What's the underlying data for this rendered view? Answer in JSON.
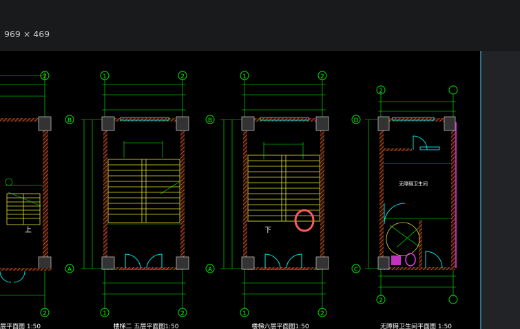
{
  "image_dimensions": "969 × 469",
  "drawing": {
    "axis_labels": {
      "two": "2",
      "one": "1",
      "B": "B",
      "A": "A",
      "D": "D",
      "C": "C"
    },
    "titles": {
      "plan_left": "层平面图 1:50",
      "plan_2_5": "楼梯二 五层平面图1:50",
      "plan_6": "楼梯六层平面图1:50",
      "plan_toilet": "无障碍卫生间平面图 1:50"
    },
    "labels": {
      "up": "上",
      "down": "下",
      "toilet_room": "无障碍卫生间"
    },
    "annotation_marker": "red-circle"
  },
  "colors": {
    "background": "#000000",
    "green_lines": "#00ff00",
    "yellow_stairs": "#e6e62e",
    "walls_hatch": "#d4502a",
    "doors_cyan": "#00e0e0",
    "highlight_red": "#ff5a5a",
    "magenta": "#e23be2"
  }
}
